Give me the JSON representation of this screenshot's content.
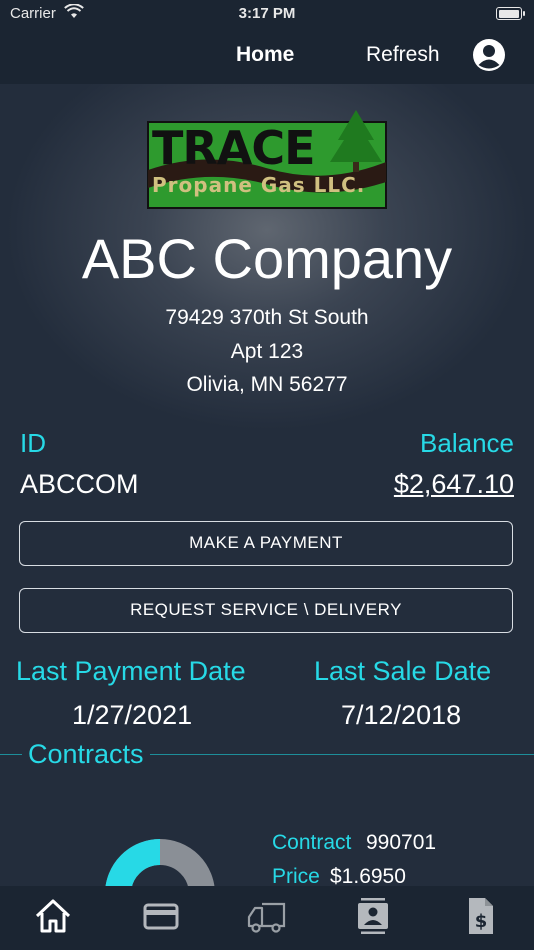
{
  "status_bar": {
    "carrier": "Carrier",
    "time": "3:17 PM"
  },
  "nav": {
    "home_label": "Home",
    "refresh_label": "Refresh",
    "user_icon": "user-circle-icon"
  },
  "logo": {
    "line1": "TRACE",
    "line2": "Propane Gas LLC."
  },
  "company": {
    "name": "ABC Company",
    "address_line1": "79429 370th St South",
    "address_line2": "Apt 123",
    "address_line3": "Olivia, MN 56277"
  },
  "account": {
    "id_label": "ID",
    "id_value": "ABCCOM",
    "balance_label": "Balance",
    "balance_value": "$2,647.10"
  },
  "actions": {
    "make_payment": "MAKE A PAYMENT",
    "request_service": "REQUEST SERVICE \\ DELIVERY"
  },
  "dates": {
    "last_payment_label": "Last Payment Date",
    "last_payment_value": "1/27/2021",
    "last_sale_label": "Last Sale Date",
    "last_sale_value": "7/12/2018"
  },
  "contracts": {
    "title": "Contracts",
    "gauge_fill_fraction": 0.5,
    "contract_label": "Contract",
    "contract_value": "990701",
    "price_label": "Price",
    "price_value": "$1.6950"
  },
  "tabs": [
    {
      "name": "home-icon",
      "active": true
    },
    {
      "name": "credit-card-icon",
      "active": false
    },
    {
      "name": "delivery-truck-icon",
      "active": false
    },
    {
      "name": "contact-card-icon",
      "active": false
    },
    {
      "name": "invoice-dollar-icon",
      "active": false
    }
  ],
  "colors": {
    "accent": "#27d9e6",
    "bar_bg": "#1b2532",
    "page_bg": "#232d3c",
    "gauge_gray": "#8a8f96"
  }
}
